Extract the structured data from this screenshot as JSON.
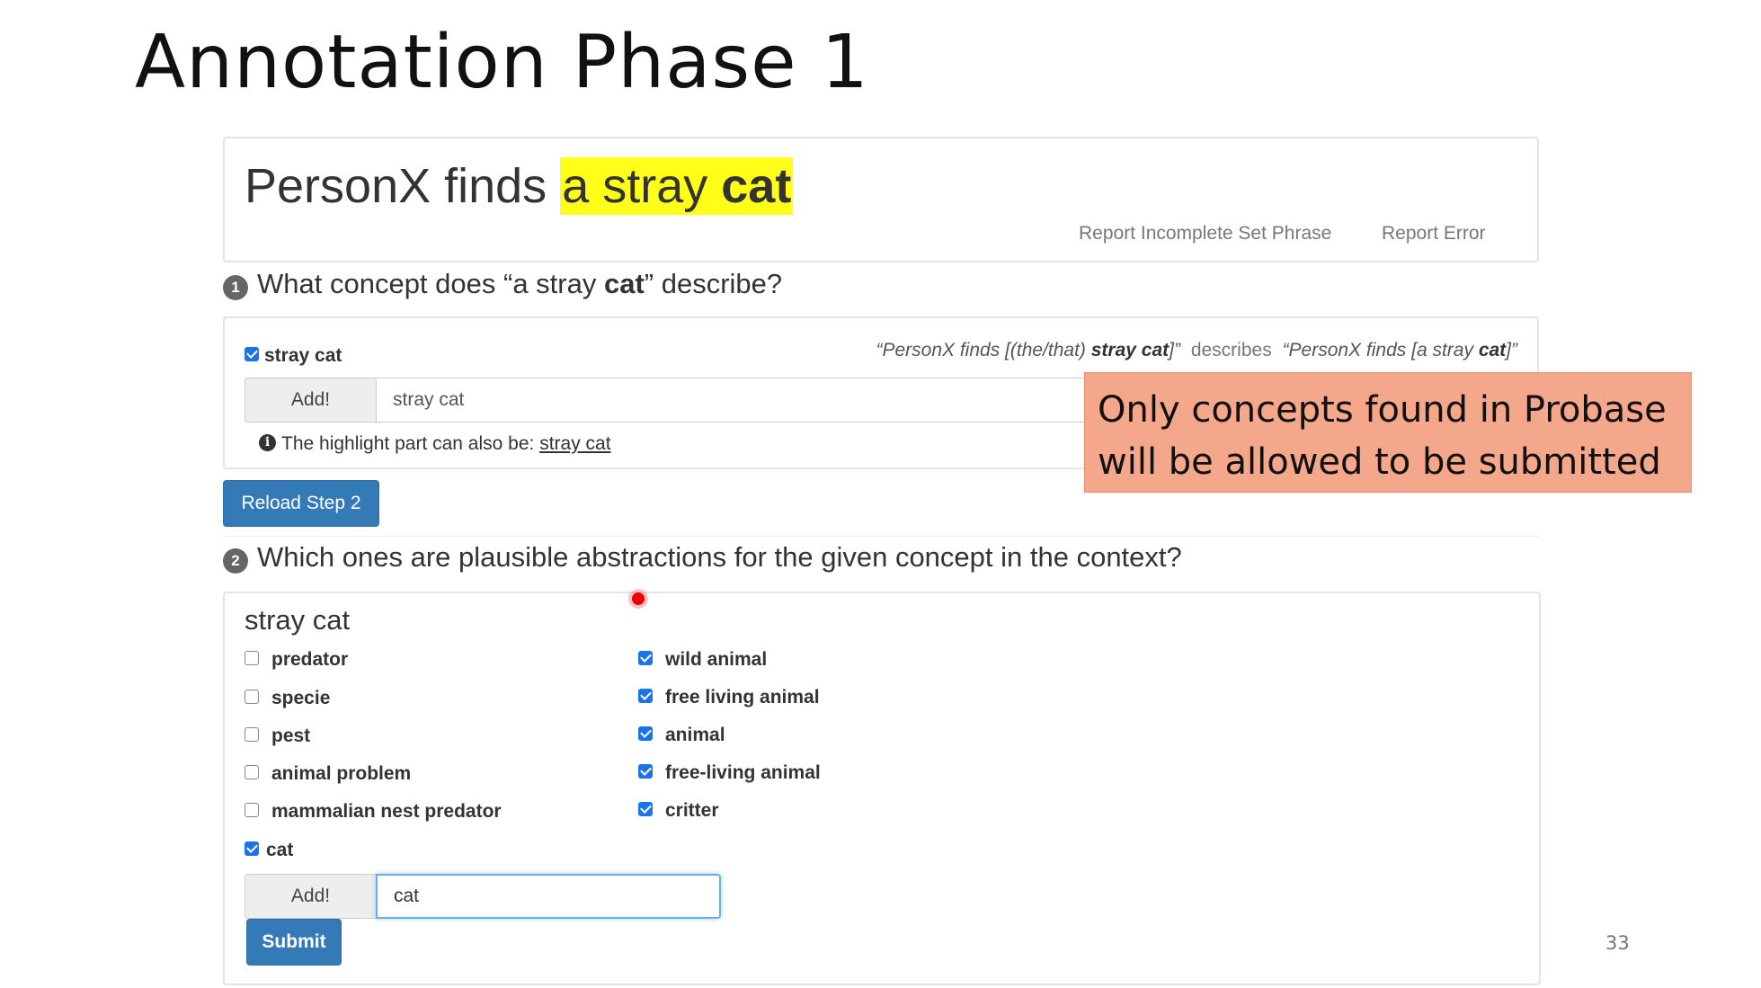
{
  "slide": {
    "title": "Annotation Phase 1",
    "page_number": "33"
  },
  "event": {
    "prefix": "PersonX finds ",
    "highlight_plain": "a stray ",
    "highlight_bold": "cat",
    "report_incomplete": "Report Incomplete Set Phrase",
    "report_error": "Report Error",
    "highlight_color": "#ffff1a"
  },
  "step1": {
    "number": "1",
    "question_prefix": "What concept does “a stray ",
    "question_bold": "cat",
    "question_suffix": "” describe?",
    "checkbox_label": "stray cat",
    "checkbox_checked": true,
    "describes_left_pre": "“PersonX finds [(the/that) ",
    "describes_left_bold": "stray cat",
    "describes_left_post": "]”",
    "describes_mid": "describes",
    "describes_right_pre": "“PersonX finds [a stray ",
    "describes_right_bold": "cat",
    "describes_right_post": "]”",
    "add_label": "Add!",
    "input_value": "stray cat",
    "hint_text": "The highlight part can also be: ",
    "hint_link": "stray cat",
    "info_icon": "i"
  },
  "reload_button": "Reload Step 2",
  "step2": {
    "number": "2",
    "question": "Which ones are plausible abstractions for the given concept in the context?",
    "concept": "stray cat",
    "left_options": [
      {
        "label": "predator",
        "checked": false
      },
      {
        "label": "specie",
        "checked": false
      },
      {
        "label": "pest",
        "checked": false
      },
      {
        "label": "animal problem",
        "checked": false
      },
      {
        "label": "mammalian nest predator",
        "checked": false
      },
      {
        "label": "cat",
        "checked": true
      }
    ],
    "right_options": [
      {
        "label": "wild animal",
        "checked": true
      },
      {
        "label": "free living animal",
        "checked": true
      },
      {
        "label": "animal",
        "checked": true
      },
      {
        "label": "free-living animal",
        "checked": true
      },
      {
        "label": "critter",
        "checked": true
      }
    ],
    "add_label": "Add!",
    "input_value": "cat",
    "submit_label": "Submit"
  },
  "callout": {
    "line1": "Only concepts found in Probase",
    "line2": "will be allowed to be submitted",
    "color": "#f4a78b"
  },
  "colors": {
    "primary_button": "#337ab7",
    "checkbox_checked": "#1a73e8"
  }
}
